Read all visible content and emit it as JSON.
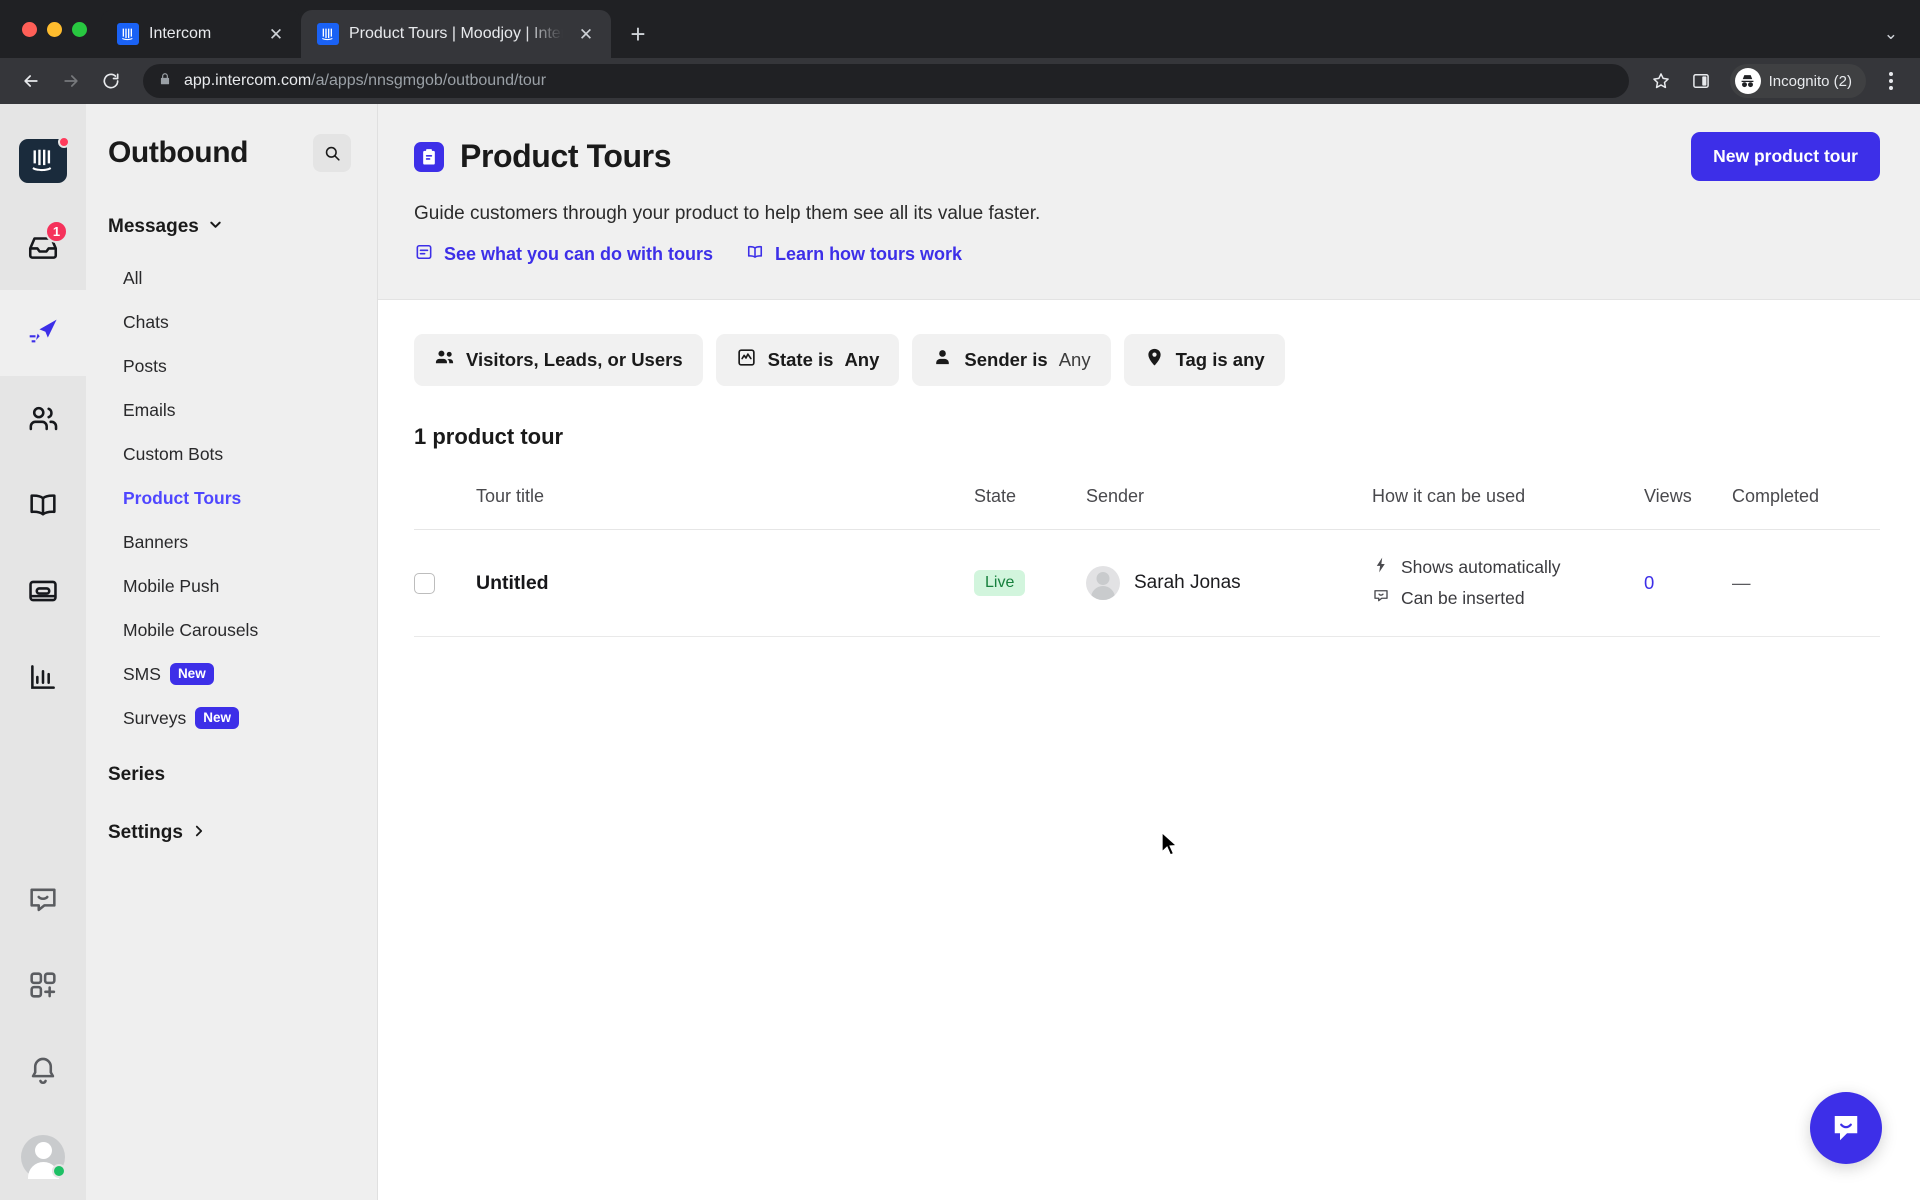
{
  "browser": {
    "tabs": [
      {
        "title": "Intercom",
        "active": false,
        "favicon": "intercom-icon"
      },
      {
        "title": "Product Tours | Moodjoy | Inter",
        "active": true,
        "favicon": "intercom-icon"
      }
    ],
    "new_tab_label": "+",
    "tab_list_chevron": "⌄",
    "close_label": "✕",
    "url_domain": "app.intercom.com",
    "url_path": "/a/apps/nnsgmgob/outbound/tour",
    "profile_label": "Incognito (2)",
    "icons": {
      "back": "back-arrow-icon",
      "forward": "forward-arrow-icon",
      "reload": "reload-icon",
      "lock": "lock-icon",
      "bookmark": "star-icon",
      "side_panel": "side-panel-icon",
      "menu": "kebab-menu-icon"
    }
  },
  "rail": {
    "items": [
      {
        "name": "intercom-logo",
        "badge": "",
        "dot": true,
        "active": false
      },
      {
        "name": "inbox-icon",
        "badge": "1",
        "dot": false,
        "active": false
      },
      {
        "name": "send-paper-plane-icon",
        "badge": "",
        "dot": false,
        "active": true
      },
      {
        "name": "contacts-people-icon",
        "badge": "",
        "dot": false,
        "active": false
      },
      {
        "name": "knowledge-book-icon",
        "badge": "",
        "dot": false,
        "active": false
      },
      {
        "name": "articles-icon",
        "badge": "",
        "dot": false,
        "active": false
      },
      {
        "name": "reports-bar-chart-icon",
        "badge": "",
        "dot": false,
        "active": false
      }
    ],
    "bottom_items": [
      {
        "name": "messenger-icon"
      },
      {
        "name": "apps-add-icon"
      },
      {
        "name": "bell-notification-icon"
      }
    ],
    "avatar_status": "online"
  },
  "sidebar": {
    "title": "Outbound",
    "search_icon": "search-icon",
    "group": {
      "label": "Messages",
      "chevron_icon": "chevron-down-icon"
    },
    "items": [
      {
        "label": "All",
        "selected": false,
        "badge": ""
      },
      {
        "label": "Chats",
        "selected": false,
        "badge": ""
      },
      {
        "label": "Posts",
        "selected": false,
        "badge": ""
      },
      {
        "label": "Emails",
        "selected": false,
        "badge": ""
      },
      {
        "label": "Custom Bots",
        "selected": false,
        "badge": ""
      },
      {
        "label": "Product Tours",
        "selected": true,
        "badge": ""
      },
      {
        "label": "Banners",
        "selected": false,
        "badge": ""
      },
      {
        "label": "Mobile Push",
        "selected": false,
        "badge": ""
      },
      {
        "label": "Mobile Carousels",
        "selected": false,
        "badge": ""
      },
      {
        "label": "SMS",
        "selected": false,
        "badge": "New"
      },
      {
        "label": "Surveys",
        "selected": false,
        "badge": "New"
      }
    ],
    "sections": [
      {
        "label": "Series",
        "chevron": ""
      },
      {
        "label": "Settings",
        "chevron": "chevron-right-icon"
      }
    ]
  },
  "header": {
    "icon": "product-tours-icon",
    "title": "Product Tours",
    "subtitle": "Guide customers through your product to help them see all its value faster.",
    "links": [
      {
        "label": "See what you can do with tours",
        "icon": "tour-card-icon"
      },
      {
        "label": "Learn how tours work",
        "icon": "book-open-icon"
      }
    ],
    "primary_button": "New product tour"
  },
  "filters": [
    {
      "label": "Visitors, Leads, or Users",
      "value": "",
      "icon": "people-icon"
    },
    {
      "label": "State is",
      "value": "Any",
      "icon": "state-chart-icon"
    },
    {
      "label": "Sender is",
      "value": "Any",
      "icon": "person-icon"
    },
    {
      "label": "Tag is any",
      "value": "",
      "icon": "tag-icon"
    }
  ],
  "list": {
    "count_label": "1 product tour",
    "columns": [
      {
        "key": "check",
        "label": ""
      },
      {
        "key": "title",
        "label": "Tour title"
      },
      {
        "key": "state",
        "label": "State"
      },
      {
        "key": "sender",
        "label": "Sender"
      },
      {
        "key": "how",
        "label": "How it can be used"
      },
      {
        "key": "views",
        "label": "Views"
      },
      {
        "key": "completed",
        "label": "Completed"
      }
    ],
    "rows": [
      {
        "checked": false,
        "title": "Untitled",
        "state": "Live",
        "sender": "Sarah Jonas",
        "how": [
          {
            "label": "Shows automatically",
            "icon": "lightning-bolt-icon"
          },
          {
            "label": "Can be inserted",
            "icon": "message-insert-icon"
          }
        ],
        "views": "0",
        "completed": "—"
      }
    ]
  },
  "launcher": {
    "icon": "intercom-messenger-icon"
  },
  "colors": {
    "accent": "#3d2fe8",
    "accent_link": "#4f46ff",
    "badge_live_bg": "#d2f5dd",
    "badge_live_text": "#17803d",
    "notification_red": "#f5325b",
    "online_green": "#1ec065",
    "sidebar_bg": "#efefef",
    "rail_bg": "#e5e5e5",
    "header_bg": "#f0f0f0",
    "chip_bg": "#f1f1f1"
  }
}
